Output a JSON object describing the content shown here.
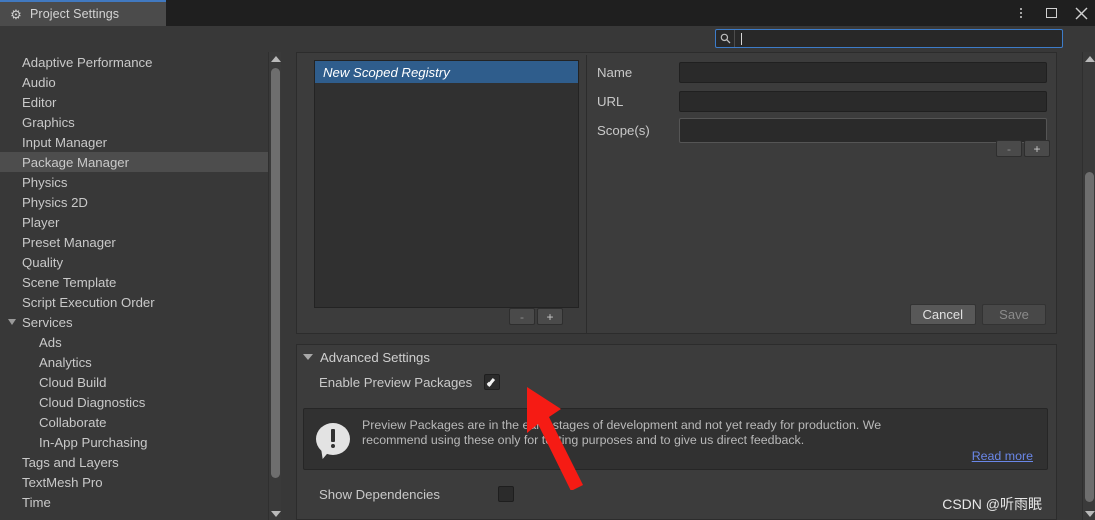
{
  "window": {
    "tab_title": "Project Settings",
    "tab_icon": "gear-icon",
    "menu_icon": "kebab-menu-icon",
    "maximize_icon": "maximize-icon",
    "close_icon": "close-icon"
  },
  "search": {
    "value": "",
    "placeholder": "",
    "icon": "search-icon"
  },
  "sidebar": {
    "items": [
      {
        "label": "Adaptive Performance",
        "level": 0,
        "selected": false,
        "expandable": false
      },
      {
        "label": "Audio",
        "level": 0,
        "selected": false,
        "expandable": false
      },
      {
        "label": "Editor",
        "level": 0,
        "selected": false,
        "expandable": false
      },
      {
        "label": "Graphics",
        "level": 0,
        "selected": false,
        "expandable": false
      },
      {
        "label": "Input Manager",
        "level": 0,
        "selected": false,
        "expandable": false
      },
      {
        "label": "Package Manager",
        "level": 0,
        "selected": true,
        "expandable": false
      },
      {
        "label": "Physics",
        "level": 0,
        "selected": false,
        "expandable": false
      },
      {
        "label": "Physics 2D",
        "level": 0,
        "selected": false,
        "expandable": false
      },
      {
        "label": "Player",
        "level": 0,
        "selected": false,
        "expandable": false
      },
      {
        "label": "Preset Manager",
        "level": 0,
        "selected": false,
        "expandable": false
      },
      {
        "label": "Quality",
        "level": 0,
        "selected": false,
        "expandable": false
      },
      {
        "label": "Scene Template",
        "level": 0,
        "selected": false,
        "expandable": false
      },
      {
        "label": "Script Execution Order",
        "level": 0,
        "selected": false,
        "expandable": false
      },
      {
        "label": "Services",
        "level": 0,
        "selected": false,
        "expandable": true
      },
      {
        "label": "Ads",
        "level": 1,
        "selected": false,
        "expandable": false
      },
      {
        "label": "Analytics",
        "level": 1,
        "selected": false,
        "expandable": false
      },
      {
        "label": "Cloud Build",
        "level": 1,
        "selected": false,
        "expandable": false
      },
      {
        "label": "Cloud Diagnostics",
        "level": 1,
        "selected": false,
        "expandable": false
      },
      {
        "label": "Collaborate",
        "level": 1,
        "selected": false,
        "expandable": false
      },
      {
        "label": "In-App Purchasing",
        "level": 1,
        "selected": false,
        "expandable": false
      },
      {
        "label": "Tags and Layers",
        "level": 0,
        "selected": false,
        "expandable": false
      },
      {
        "label": "TextMesh Pro",
        "level": 0,
        "selected": false,
        "expandable": false
      },
      {
        "label": "Time",
        "level": 0,
        "selected": false,
        "expandable": false
      }
    ]
  },
  "registry": {
    "list": [
      {
        "name": "New Scoped Registry",
        "selected": true
      }
    ],
    "list_remove_label": "-",
    "list_add_label": "+",
    "fields": [
      {
        "label": "Name",
        "value": ""
      },
      {
        "label": "URL",
        "value": ""
      },
      {
        "label": "Scope(s)",
        "value": ""
      }
    ],
    "scope_remove_label": "-",
    "scope_add_label": "+",
    "cancel_label": "Cancel",
    "save_label": "Save"
  },
  "advanced": {
    "title": "Advanced Settings",
    "preview_label": "Enable Preview Packages",
    "preview_checked": true,
    "info_line1": "Preview Packages are in the early stages of development and not yet ready for production. We",
    "info_line2": "recommend using these only for testing purposes and to give us direct feedback.",
    "read_more": "Read more",
    "read_more_color": "#6a87e8",
    "info_icon": "warning-bubble-icon",
    "dependencies_label": "Show Dependencies",
    "dependencies_checked": false
  },
  "watermark": "CSDN @听雨眠",
  "colors": {
    "accent_selected": "#2f5d8c",
    "focus_border": "#3d7cc9",
    "panel": "#3c3c3c",
    "background": "#383838",
    "arrow": "#f61b14"
  }
}
